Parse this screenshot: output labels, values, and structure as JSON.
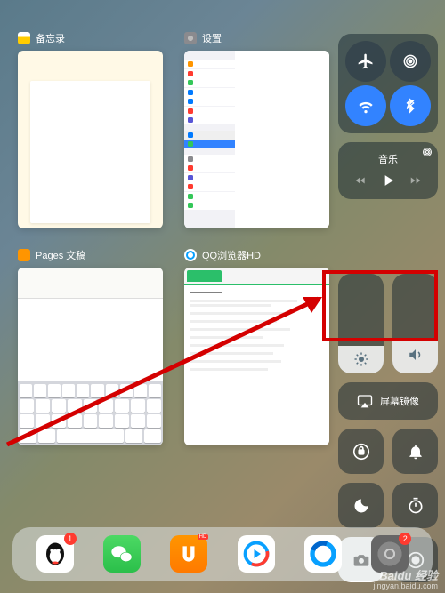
{
  "apps": {
    "notes": {
      "title": "备忘录",
      "icon_color": "#ffcc00"
    },
    "settings": {
      "title": "设置",
      "icon_color": "#8a8a8e"
    },
    "pages": {
      "title": "Pages 文稿",
      "icon_color": "#ff9500"
    },
    "qqbrowser": {
      "title": "QQ浏览器HD",
      "icon_color": "#08a0ff"
    }
  },
  "control_center": {
    "music_label": "音乐",
    "screen_mirror_label": "屏幕镜像",
    "brightness_pct": 28,
    "volume_pct": 32
  },
  "dock": {
    "badges": {
      "qq": "1",
      "gear": "2"
    }
  },
  "watermark": {
    "brand": "Baidu 经验",
    "url": "jingyan.baidu.com"
  }
}
